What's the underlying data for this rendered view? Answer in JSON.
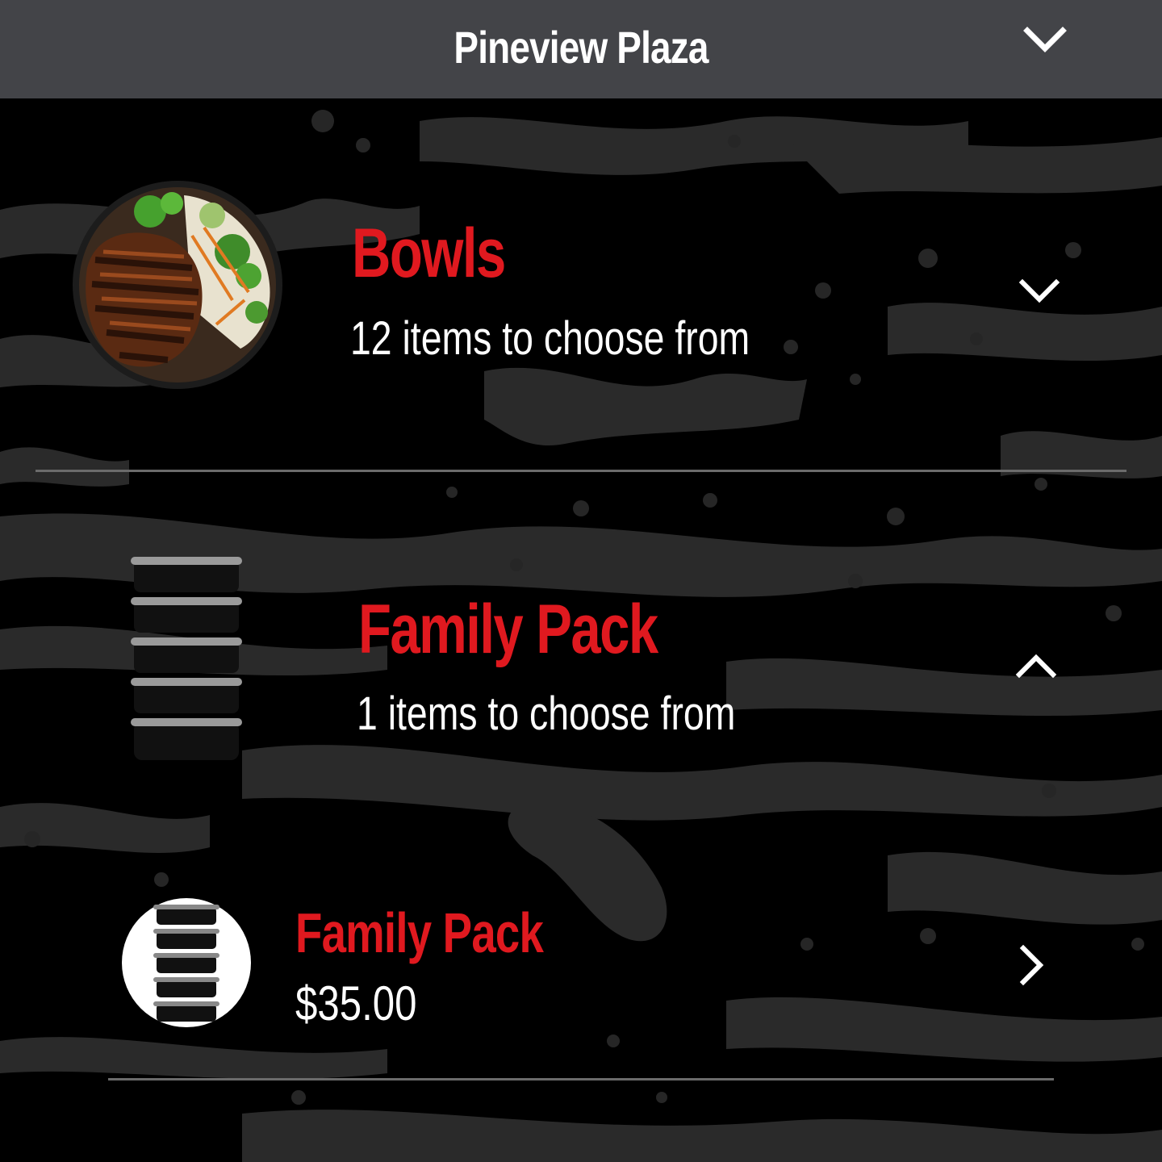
{
  "header": {
    "location": "Pineview Plaza",
    "location_dropdown_icon": "chevron-down-icon"
  },
  "categories": [
    {
      "name": "Bowls",
      "count_text": "12 items to choose from",
      "image": "teriyaki-chicken-bowl",
      "toggle_icon": "chevron-down-icon",
      "expanded": false
    },
    {
      "name": "Family Pack",
      "count_text": "1 items to choose from",
      "image": "stacked-containers",
      "toggle_icon": "chevron-up-icon",
      "expanded": true,
      "items": [
        {
          "name": "Family Pack",
          "price": "$35.00",
          "image": "stacked-containers",
          "open_icon": "chevron-right-icon"
        }
      ]
    }
  ],
  "colors": {
    "header_bg": "#434448",
    "accent_red": "#e0191f",
    "text": "#ffffff",
    "divider": "#6b6b6b",
    "background": "#000000"
  }
}
